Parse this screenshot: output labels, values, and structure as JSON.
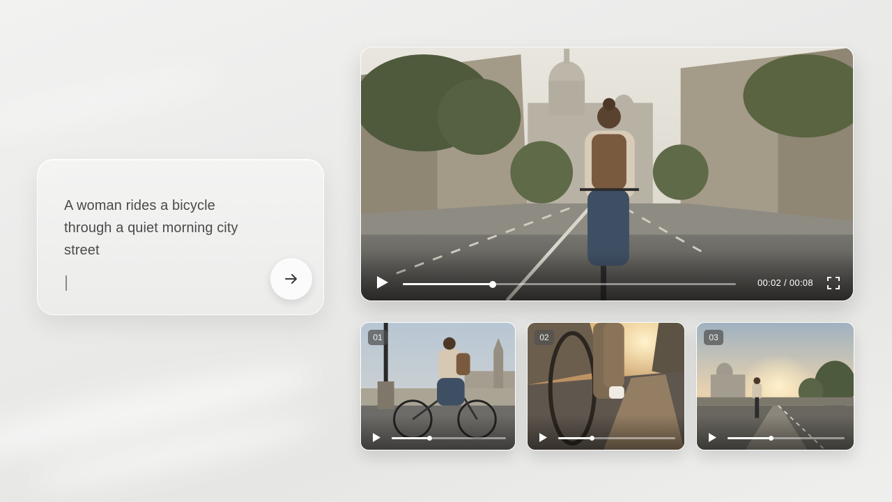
{
  "prompt": {
    "text": "A woman rides a bicycle through a quiet morning city street",
    "send_icon": "arrow-right-icon"
  },
  "main_video": {
    "current_time": "00:02",
    "separator": "/",
    "duration": "00:08",
    "progress": 0.27,
    "play_icon": "play-icon",
    "fullscreen_icon": "fullscreen-icon"
  },
  "variations": [
    {
      "badge": "01",
      "progress": 0.33
    },
    {
      "badge": "02",
      "progress": 0.29
    },
    {
      "badge": "03",
      "progress": 0.37
    }
  ],
  "colors": {
    "background": "#ebebea",
    "card": "#f1f1f0",
    "text": "#4a4a4a",
    "control": "#ffffff"
  }
}
